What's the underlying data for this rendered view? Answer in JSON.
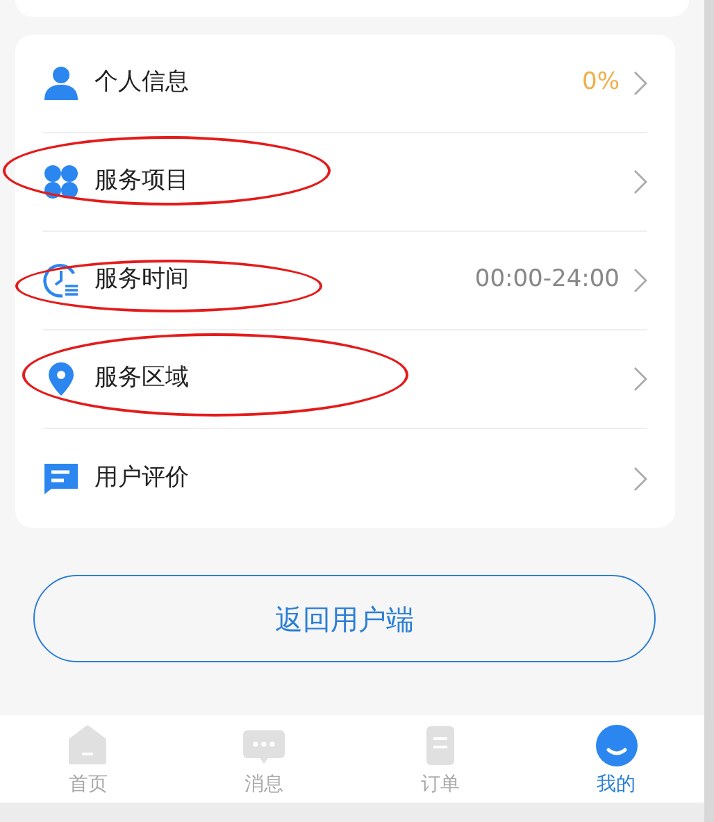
{
  "menu": [
    {
      "kind": "person",
      "label": "个人信息",
      "value": {
        "text": "0%",
        "color": "#f0b04a"
      },
      "circled": false
    },
    {
      "kind": "grid",
      "label": "服务项目",
      "circled": true
    },
    {
      "kind": "clock",
      "label": "服务时间",
      "value": {
        "text": "00:00-24:00",
        "color": "#888888"
      },
      "circled": true
    },
    {
      "kind": "pin",
      "label": "服务区域",
      "circled": true
    },
    {
      "kind": "chat",
      "label": "用户评价",
      "circled": false
    }
  ],
  "return_button": "返回用户端",
  "tabbar": [
    {
      "kind": "home",
      "label": "首页",
      "selected": false
    },
    {
      "kind": "message",
      "label": "消息",
      "selected": false
    },
    {
      "kind": "order",
      "label": "订单",
      "selected": false
    },
    {
      "kind": "me",
      "label": "我的",
      "selected": true
    }
  ]
}
